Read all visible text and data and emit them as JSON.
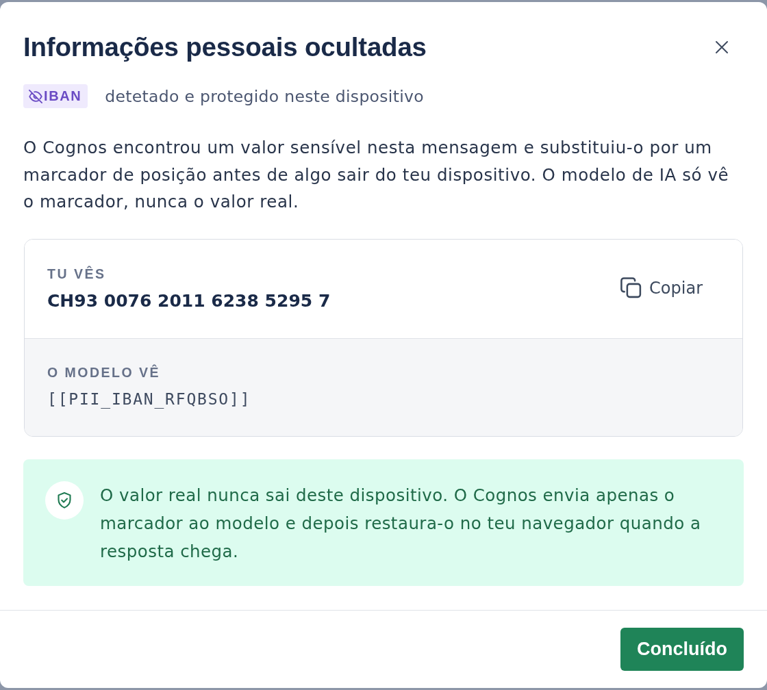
{
  "dialog": {
    "title": "Informações pessoais ocultadas"
  },
  "detection": {
    "badge": "IBAN",
    "caption": "detetado e protegido neste dispositivo"
  },
  "description": "O Cognos encontrou um valor sensível nesta mensagem e substituiu-o por um marcador de posição antes de algo sair do teu dispositivo. O modelo de IA só vê o marcador, nunca o valor real.",
  "comparison": {
    "user_view": {
      "label": "TU VÊS",
      "value": "CH93 0076 2011 6238 5295 7",
      "copy_button": "Copiar"
    },
    "model_view": {
      "label": "O MODELO VÊ",
      "value": "[[PII_IBAN_RFQBSO]]"
    }
  },
  "notice": {
    "text": "O valor real nunca sai deste dispositivo. O Cognos envia apenas o marcador ao modelo e depois restaura-o no teu navegador quando a resposta chega."
  },
  "footer": {
    "buttons": [
      "Concluído"
    ]
  }
}
